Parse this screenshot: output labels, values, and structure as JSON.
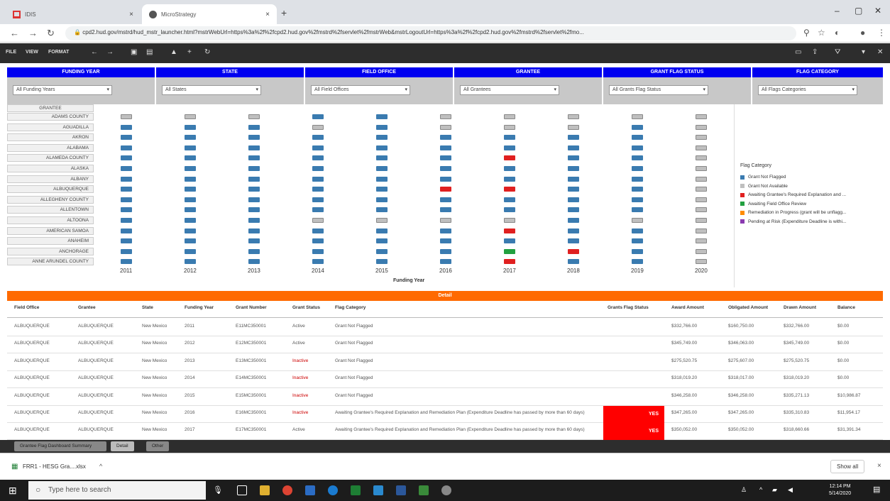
{
  "browser": {
    "tab1_title": "IDIS",
    "tab2_title": "MicroStrategy",
    "url": "cpd2.hud.gov/mstrd/hud_mstr_launcher.html?mstrWebUrl=https%3a%2f%2fcpd2.hud.gov%2fmstrd%2fservlet%2fmstrWeb&mstrLogoutUrl=https%3a%2f%2fcpd2.hud.gov%2fmstrd%2fservlet%2fmo..."
  },
  "app_menu": [
    "FILE",
    "VIEW",
    "FORMAT"
  ],
  "filters": [
    {
      "header": "FUNDING YEAR",
      "value": "All Funding Years"
    },
    {
      "header": "STATE",
      "value": "All States"
    },
    {
      "header": "FIELD OFFICE",
      "value": "All Field Offices"
    },
    {
      "header": "GRANTEE",
      "value": "All Grantees"
    },
    {
      "header": "GRANT FLAG STATUS",
      "value": "All Grants Flag Status"
    },
    {
      "header": "FLAG CATEGORY",
      "value": "All Flags Categories"
    }
  ],
  "grid": {
    "header": "Grantee",
    "grantees": [
      "ADAMS COUNTY",
      "AGUADILLA",
      "AKRON",
      "ALABAMA",
      "ALAMEDA COUNTY",
      "ALASKA",
      "ALBANY",
      "ALBUQUERQUE",
      "ALLEGHENY COUNTY",
      "ALLENTOWN",
      "ALTOONA",
      "AMERICAN SAMOA",
      "Anaheim",
      "ANCHORAGE",
      "ANNE ARUNDEL COUNTY"
    ],
    "years": [
      "2011",
      "2012",
      "2013",
      "2014",
      "2015",
      "2016",
      "2017",
      "2018",
      "2019",
      "2020"
    ],
    "xlabel": "Funding Year",
    "cells": [
      "gggbbggggg",
      "bbbgbgggbg",
      "bbbbbbbbbg",
      "bbbbbbbbbg",
      "bbbbbbrbbg",
      "bbbbbbbbbg",
      "bbbbbbbbbg",
      "bbbbbrrbbg",
      "bbbbbbbbbg",
      "bbbbbbbbbg",
      "bbbggggbgg",
      "bbbbbbrbbg",
      "bbbbbbbbbg",
      "bbbbbbgrbg",
      "bbbbbbrbbg"
    ]
  },
  "legend": {
    "title": "Flag Category",
    "items": [
      {
        "label": "Grant Not Flagged",
        "color": "#3a7bb0"
      },
      {
        "label": "Grant Not Available",
        "color": "#bfbfbf"
      },
      {
        "label": "Awaiting Grantee's Required Explanation and ...",
        "color": "#e02020"
      },
      {
        "label": "Awaiting Field Office Review",
        "color": "#22a040"
      },
      {
        "label": "Remediation in Progress (grant will be unflagg...",
        "color": "#ff8c00"
      },
      {
        "label": "Pending at Risk (Expenditure Deadline is withi...",
        "color": "#8a3ab0"
      }
    ]
  },
  "detail": {
    "title": "Detail",
    "columns": [
      "Field Office",
      "Grantee",
      "State",
      "Funding Year",
      "Grant Number",
      "Grant Status",
      "Flag Category",
      "Grants Flag Status",
      "Award Amount",
      "Obligated Amount",
      "Drawn Amount",
      "Balance"
    ],
    "rows": [
      {
        "fo": "ALBUQUERQUE",
        "grantee": "ALBUQUERQUE",
        "state": "New Mexico",
        "year": "2011",
        "grant": "E11MC350001",
        "status": "Active",
        "flag": "Grant Not Flagged",
        "gfs": "",
        "award": "$332,766.00",
        "obligated": "$160,750.00",
        "drawn": "$332,766.00",
        "balance": "$0.00",
        "red": false
      },
      {
        "fo": "ALBUQUERQUE",
        "grantee": "ALBUQUERQUE",
        "state": "New Mexico",
        "year": "2012",
        "grant": "E12MC350001",
        "status": "Active",
        "flag": "Grant Not Flagged",
        "gfs": "",
        "award": "$345,749.00",
        "obligated": "$346,063.00",
        "drawn": "$345,749.00",
        "balance": "$0.00",
        "red": false
      },
      {
        "fo": "ALBUQUERQUE",
        "grantee": "ALBUQUERQUE",
        "state": "New Mexico",
        "year": "2013",
        "grant": "E13MC350001",
        "status": "Inactive",
        "flag": "Grant Not Flagged",
        "gfs": "",
        "award": "$275,520.75",
        "obligated": "$275,607.00",
        "drawn": "$275,520.75",
        "balance": "$0.00",
        "red": true
      },
      {
        "fo": "ALBUQUERQUE",
        "grantee": "ALBUQUERQUE",
        "state": "New Mexico",
        "year": "2014",
        "grant": "E14MC350001",
        "status": "Inactive",
        "flag": "Grant Not Flagged",
        "gfs": "",
        "award": "$318,019.20",
        "obligated": "$318,017.00",
        "drawn": "$318,019.20",
        "balance": "$0.00",
        "red": true
      },
      {
        "fo": "ALBUQUERQUE",
        "grantee": "ALBUQUERQUE",
        "state": "New Mexico",
        "year": "2015",
        "grant": "E15MC350001",
        "status": "Inactive",
        "flag": "Grant Not Flagged",
        "gfs": "",
        "award": "$346,258.00",
        "obligated": "$346,258.00",
        "drawn": "$335,271.13",
        "balance": "$10,986.87",
        "red": true
      },
      {
        "fo": "ALBUQUERQUE",
        "grantee": "ALBUQUERQUE",
        "state": "New Mexico",
        "year": "2016",
        "grant": "E16MC350001",
        "status": "Inactive",
        "flag": "Awaiting Grantee's Required Explanation and Remediation Plan (Expenditure Deadline has passed by more than 60 days)",
        "gfs": "YES",
        "award": "$347,265.00",
        "obligated": "$347,265.00",
        "drawn": "$335,310.83",
        "balance": "$11,954.17",
        "red": true
      },
      {
        "fo": "ALBUQUERQUE",
        "grantee": "ALBUQUERQUE",
        "state": "New Mexico",
        "year": "2017",
        "grant": "E17MC350001",
        "status": "Active",
        "flag": "Awaiting Grantee's Required Explanation and Remediation Plan (Expenditure Deadline has passed by more than 60 days)",
        "gfs": "YES",
        "award": "$350,052.00",
        "obligated": "$350,052.00",
        "drawn": "$318,660.66",
        "balance": "$31,391.34",
        "red": false
      }
    ]
  },
  "sheet_tabs": [
    "Grantee Flag Dashboard Summary",
    "Detail",
    "Other"
  ],
  "download": {
    "file": "FRR1 - HESG Gra....xlsx",
    "show_all": "Show all"
  },
  "taskbar": {
    "search_placeholder": "Type here to search",
    "time": "12:14 PM",
    "date": "5/14/2020"
  }
}
